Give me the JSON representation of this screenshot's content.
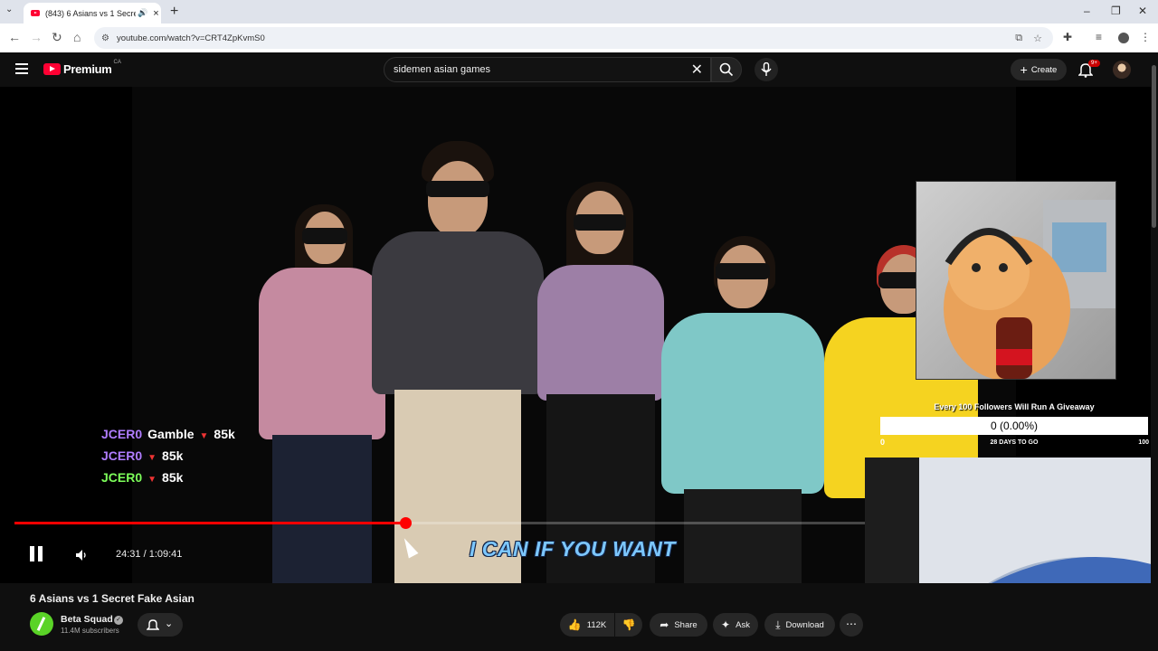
{
  "browser": {
    "tab_title": "(843) 6 Asians vs 1 Secret Fa",
    "url": "youtube.com/watch?v=CRT4ZpKvmS0"
  },
  "youtube": {
    "logo_text": "Premium",
    "country": "CA",
    "search_value": "sidemen asian games",
    "create_label": "Create",
    "notification_count": "9+"
  },
  "player": {
    "caption": "I CAN IF YOU WANT",
    "current_time": "24:31",
    "duration": "1:09:41",
    "time_display": "24:31 / 1:09:41",
    "progress_fraction": 0.46
  },
  "overlay": {
    "chat": [
      {
        "name": "JCER0",
        "game": "Gamble",
        "value": "85k",
        "color": "#b07dff"
      },
      {
        "name": "JCER0",
        "game": "",
        "value": "85k",
        "color": "#b07dff"
      },
      {
        "name": "JCER0",
        "game": "",
        "value": "85k",
        "color": "#7dff5a"
      }
    ],
    "giveaway_title": "Every 100 Followers Will Run A Giveaway",
    "giveaway_progress": "0 (0.00%)",
    "giveaway_min": "0",
    "giveaway_days": "28 DAYS TO GO",
    "giveaway_max": "100"
  },
  "video": {
    "title": "6 Asians vs 1 Secret Fake Asian",
    "channel": "Beta Squad",
    "subscribers": "11.4M subscribers",
    "likes": "112K",
    "share_label": "Share",
    "ask_label": "Ask",
    "download_label": "Download"
  }
}
